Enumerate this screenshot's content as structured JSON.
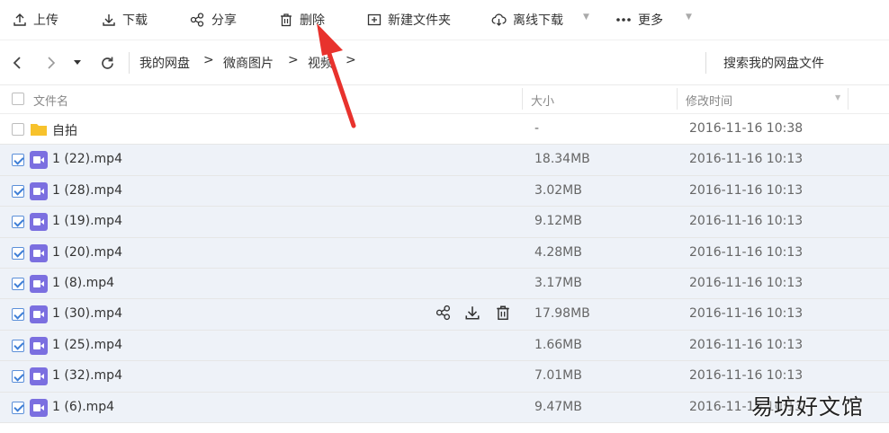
{
  "toolbar": {
    "upload": "上传",
    "download": "下载",
    "share": "分享",
    "delete": "删除",
    "new_folder": "新建文件夹",
    "offline_download": "离线下载",
    "more": "更多"
  },
  "nav": {
    "breadcrumbs": [
      "我的网盘",
      "微商图片",
      "视频"
    ],
    "search_label": "搜索我的网盘文件"
  },
  "table": {
    "col_name": "文件名",
    "col_size": "大小",
    "col_modified": "修改时间",
    "rows": [
      {
        "name": "自拍",
        "type": "folder",
        "size": "-",
        "modified": "2016-11-16 10:38",
        "checked": false
      },
      {
        "name": "1 (22).mp4",
        "type": "video",
        "size": "18.34MB",
        "modified": "2016-11-16 10:13",
        "checked": true
      },
      {
        "name": "1 (28).mp4",
        "type": "video",
        "size": "3.02MB",
        "modified": "2016-11-16 10:13",
        "checked": true
      },
      {
        "name": "1 (19).mp4",
        "type": "video",
        "size": "9.12MB",
        "modified": "2016-11-16 10:13",
        "checked": true
      },
      {
        "name": "1 (20).mp4",
        "type": "video",
        "size": "4.28MB",
        "modified": "2016-11-16 10:13",
        "checked": true
      },
      {
        "name": "1 (8).mp4",
        "type": "video",
        "size": "3.17MB",
        "modified": "2016-11-16 10:13",
        "checked": true
      },
      {
        "name": "1 (30).mp4",
        "type": "video",
        "size": "17.98MB",
        "modified": "2016-11-16 10:13",
        "checked": true,
        "hover": true
      },
      {
        "name": "1 (25).mp4",
        "type": "video",
        "size": "1.66MB",
        "modified": "2016-11-16 10:13",
        "checked": true
      },
      {
        "name": "1 (32).mp4",
        "type": "video",
        "size": "7.01MB",
        "modified": "2016-11-16 10:13",
        "checked": true
      },
      {
        "name": "1 (6).mp4",
        "type": "video",
        "size": "9.47MB",
        "modified": "2016-11-16 10:13",
        "checked": true
      }
    ]
  },
  "watermark": "易坊好文馆",
  "colors": {
    "video_icon": "#7b6fe0",
    "folder_icon": "#f7c22c",
    "selected_row": "#eef2f8",
    "checkbox": "#3f7fd6",
    "annotation_arrow": "#e8322d"
  }
}
